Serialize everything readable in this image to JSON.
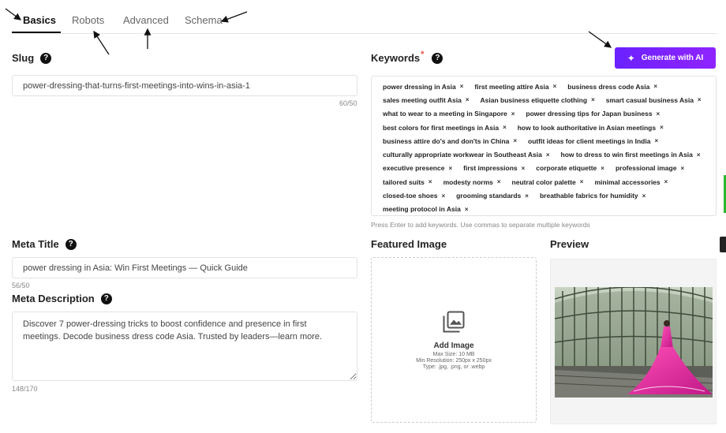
{
  "tabs": [
    {
      "label": "Basics"
    },
    {
      "label": "Robots"
    },
    {
      "label": "Advanced"
    },
    {
      "label": "Schema"
    }
  ],
  "slug": {
    "label": "Slug",
    "value": "power-dressing-that-turns-first-meetings-into-wins-in-asia-1",
    "counter": "60/50"
  },
  "meta_title": {
    "label": "Meta Title",
    "value": "power dressing in Asia: Win First Meetings — Quick Guide",
    "counter": "56/50"
  },
  "meta_description": {
    "label": "Meta Description",
    "value": "Discover 7 power-dressing tricks to boost confidence and presence in first meetings. Decode business dress code Asia. Trusted by leaders—learn more.",
    "counter": "148/170"
  },
  "keywords": {
    "label": "Keywords",
    "required_mark": "*",
    "generate_label": "Generate with AI",
    "rows": [
      [
        "power dressing in Asia",
        "first meeting attire Asia",
        "business dress code Asia"
      ],
      [
        "sales meeting outfit Asia",
        "Asian business etiquette clothing",
        "smart casual business Asia"
      ],
      [
        "what to wear to a meeting in Singapore",
        "power dressing tips for Japan business"
      ],
      [
        "best colors for first meetings in Asia",
        "how to look authoritative in Asian meetings"
      ],
      [
        "business attire do's and don'ts in China",
        "outfit ideas for client meetings in India"
      ],
      [
        "culturally appropriate workwear in Southeast Asia",
        "how to dress to win first meetings in Asia"
      ],
      [
        "executive presence",
        "first impressions",
        "corporate etiquette",
        "professional image"
      ],
      [
        "tailored suits",
        "modesty norms",
        "neutral color palette",
        "minimal accessories"
      ],
      [
        "closed-toe shoes",
        "grooming standards",
        "breathable fabrics for humidity"
      ],
      [
        "meeting protocol in Asia"
      ]
    ],
    "remove_glyph": "×",
    "hint": "Press Enter to add keywords. Use commas to separate multiple keywords"
  },
  "featured_image": {
    "label": "Featured Image",
    "add_label": "Add Image",
    "max_size": "Max Size: 10 MB",
    "min_resolution": "Min Resolution: 250px x 250px",
    "type": "Type: .jpg, .png, or .webp"
  },
  "preview": {
    "label": "Preview"
  },
  "help_glyph": "?",
  "colors": {
    "accent_start": "#6b21ff",
    "accent_end": "#8f24ff",
    "required": "#e74c3c"
  }
}
